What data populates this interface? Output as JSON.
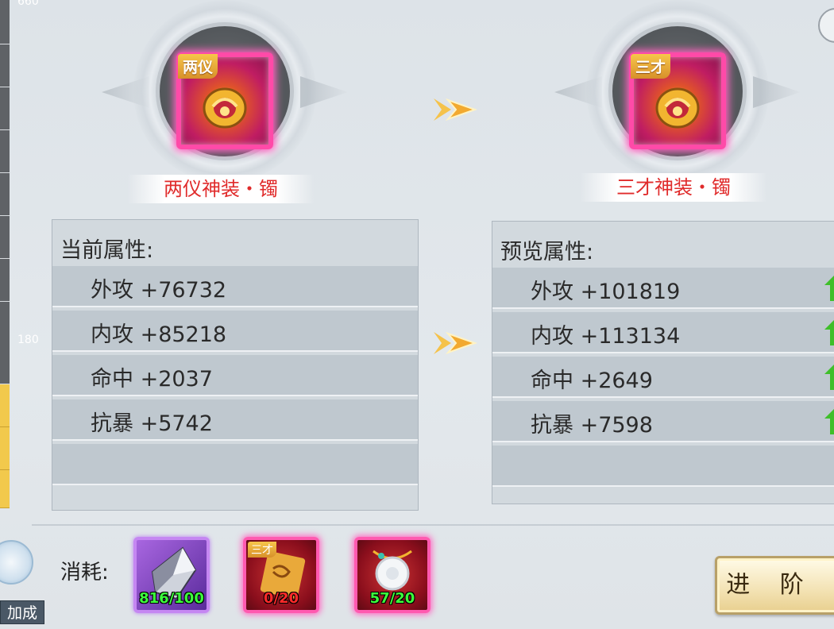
{
  "left_strip": {
    "top_number": "660",
    "mid_number": "180"
  },
  "current_item": {
    "tier_tag": "两仪",
    "name": "两仪神装・镯"
  },
  "next_item": {
    "tier_tag": "三才",
    "name": "三才神装・镯"
  },
  "current_attributes": {
    "title": "当前属性:",
    "rows": [
      "外攻 +76732",
      "内攻 +85218",
      "命中 +2037",
      "抗暴 +5742"
    ]
  },
  "preview_attributes": {
    "title": "预览属性:",
    "rows": [
      "外攻 +101819",
      "内攻 +113134",
      "命中 +2649",
      "抗暴 +7598"
    ]
  },
  "consumption": {
    "label": "消耗:",
    "items": [
      {
        "count": "816/100",
        "icon": "crystal-stone-icon"
      },
      {
        "tag": "三才",
        "count": "0/20",
        "icon": "scroll-icon"
      },
      {
        "count": "57/20",
        "icon": "jade-pendant-icon"
      }
    ]
  },
  "advance_button": "进 阶",
  "bonus_label": "加成",
  "colors": {
    "item_name": "#e02b2b",
    "count_ok": "#3cff3c",
    "count_low": "#ff2a2a",
    "upgrade_arrow": "#3fbf2a"
  }
}
